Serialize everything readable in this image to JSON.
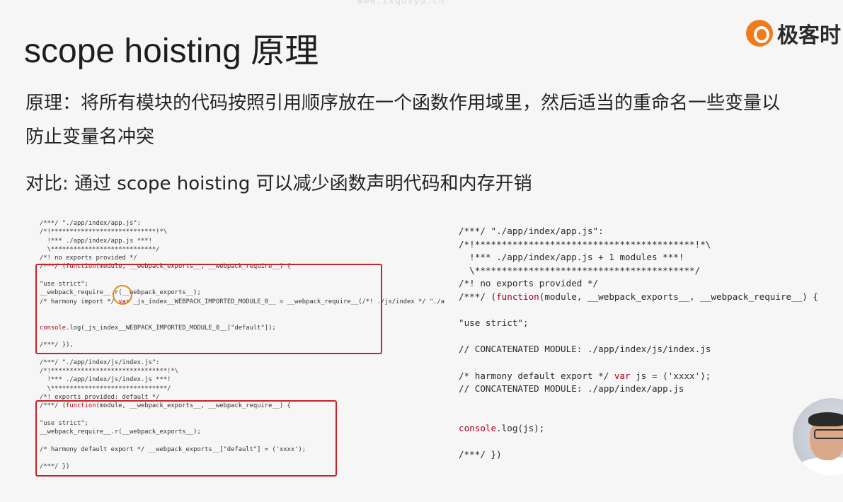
{
  "watermark": "www.ixqoxyd.cn",
  "logo": {
    "text": "极客时",
    "icon": "geek-time-logo-icon"
  },
  "title": "scope hoisting 原理",
  "principle_text": "原理：将所有模块的代码按照引用顺序放在一个函数作用域里，然后适当的重命名一些变量以防止变量名冲突",
  "compare_text": "对比: 通过 scope hoisting 可以减少函数声明代码和内存开销",
  "code_left": {
    "lines": [
      "/***/ \"./app/index/app.js\":",
      "/*!****************************!*\\",
      "  !*** ./app/index/app.js ***!",
      "  \\****************************/",
      "/*! no exports provided */",
      "/***/ (function(module, __webpack_exports__, __webpack_require__) {",
      "",
      "\"use strict\";",
      "__webpack_require__.r(__webpack_exports__);",
      "/* harmony import */ var _js_index__WEBPACK_IMPORTED_MODULE_0__ = __webpack_require__(/*! ./js/index */ \"./a",
      "",
      "",
      "console.log(_js_index__WEBPACK_IMPORTED_MODULE_0__[\"default\"]);",
      "",
      "/***/ }),",
      "",
      "/***/ \"./app/index/js/index.js\":",
      "/*!*******************************!*\\",
      "  !*** ./app/index/js/index.js ***!",
      "  \\*******************************/",
      "/*! exports provided: default */",
      "/***/ (function(module, __webpack_exports__, __webpack_require__) {",
      "",
      "\"use strict\";",
      "__webpack_require__.r(__webpack_exports__);",
      "",
      "/* harmony default export */ __webpack_exports__[\"default\"] = ('xxxx');",
      "",
      "/***/ })"
    ]
  },
  "code_right": {
    "lines": [
      "/***/ \"./app/index/app.js\":",
      "/*!*****************************************!*\\",
      "  !*** ./app/index/app.js + 1 modules ***!",
      "  \\*****************************************/",
      "/*! no exports provided */",
      "/***/ (function(module, __webpack_exports__, __webpack_require__) {",
      "",
      "\"use strict\";",
      "",
      "// CONCATENATED MODULE: ./app/index/js/index.js",
      "",
      "/* harmony default export */ var js = ('xxxx');",
      "// CONCATENATED MODULE: ./app/index/app.js",
      "",
      "",
      "console.log(js);",
      "",
      "/***/ })"
    ]
  },
  "colors": {
    "highlight_box": "#c8222b",
    "cursor_circle": "#e08a20",
    "keyword": "#a8001a",
    "logo": "#f07b1d"
  }
}
